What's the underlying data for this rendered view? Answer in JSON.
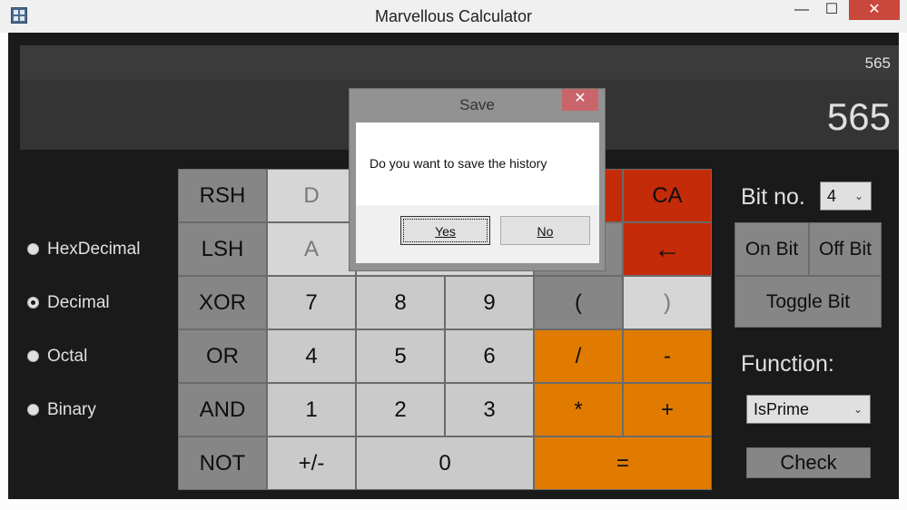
{
  "window": {
    "title": "Marvellous Calculator",
    "minimize": "—",
    "maximize": "☐",
    "close": "✕"
  },
  "display": {
    "expression": "565",
    "result": "565"
  },
  "radix": [
    {
      "label": "HexDecimal",
      "selected": false
    },
    {
      "label": "Decimal",
      "selected": true
    },
    {
      "label": "Octal",
      "selected": false
    },
    {
      "label": "Binary",
      "selected": false
    }
  ],
  "keys": {
    "rsh": "RSH",
    "lsh": "LSH",
    "xor": "XOR",
    "or": "OR",
    "and": "AND",
    "not": "NOT",
    "d": "D",
    "a": "A",
    "seven": "7",
    "eight": "8",
    "nine": "9",
    "four": "4",
    "five": "5",
    "six": "6",
    "one": "1",
    "two": "2",
    "three": "3",
    "plusminus": "+/-",
    "zero": "0",
    "ca": "CA",
    "backspace": "←",
    "lparen": "(",
    "rparen": ")",
    "divide": "/",
    "minus": "-",
    "multiply": "*",
    "plus": "+",
    "equals": "="
  },
  "bits": {
    "label": "Bit no.",
    "value": "4",
    "on_bit": "On Bit",
    "off_bit": "Off Bit",
    "toggle_bit": "Toggle Bit"
  },
  "function": {
    "label": "Function:",
    "value": "IsPrime",
    "check": "Check"
  },
  "dialog": {
    "title": "Save",
    "close": "✕",
    "message": "Do you want to save the history",
    "yes": "Yes",
    "no": "No"
  }
}
